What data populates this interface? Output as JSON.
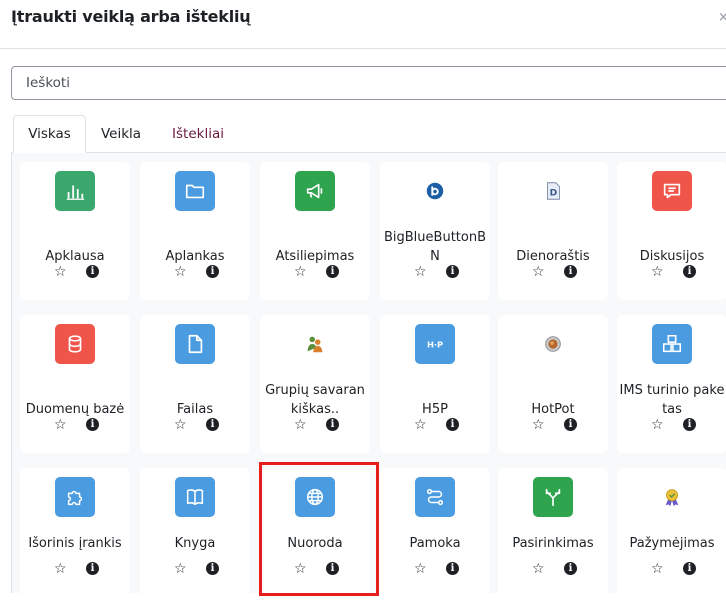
{
  "dialog": {
    "title": "Įtraukti veiklą arba išteklių",
    "close_glyph": "×"
  },
  "search": {
    "placeholder": "Ieškoti",
    "value": ""
  },
  "tabs": [
    {
      "label": "Viskas",
      "active": true
    },
    {
      "label": "Veikla",
      "active": false
    },
    {
      "label": "Ištekliai",
      "active": false
    }
  ],
  "colors": {
    "green": "#2ea44f",
    "blue": "#3e8ed8",
    "red": "#f0554a",
    "highlight": "#e81c1c",
    "link": "#6a1b3f"
  },
  "items": [
    {
      "name": "Apklausa",
      "icon": "bar-chart-icon",
      "color": "#3aa76d"
    },
    {
      "name": "Aplankas",
      "icon": "folder-icon",
      "color": "#4a9be0"
    },
    {
      "name": "Atsiliepimas",
      "icon": "megaphone-icon",
      "color": "#2ea44f"
    },
    {
      "name": "BigBlueButtonBN",
      "icon": "bigbluebutton-icon",
      "color": "#ffffff"
    },
    {
      "name": "Dienoraštis",
      "icon": "journal-icon",
      "color": "#ffffff"
    },
    {
      "name": "Diskusijos",
      "icon": "forum-icon",
      "color": "#f0554a"
    },
    {
      "name": "Duomenų bazė",
      "icon": "database-icon",
      "color": "#f0554a"
    },
    {
      "name": "Failas",
      "icon": "file-icon",
      "color": "#4a9be0"
    },
    {
      "name": "Grupių savarankiškas..",
      "icon": "group-selfselect-icon",
      "color": "#ffffff"
    },
    {
      "name": "H5P",
      "icon": "h5p-icon",
      "color": "#4a9be0"
    },
    {
      "name": "HotPot",
      "icon": "hotpot-icon",
      "color": "#ffffff"
    },
    {
      "name": "IMS turinio paketas",
      "icon": "package-icon",
      "color": "#4a9be0"
    },
    {
      "name": "Išorinis įrankis",
      "icon": "puzzle-icon",
      "color": "#4a9be0"
    },
    {
      "name": "Knyga",
      "icon": "book-icon",
      "color": "#4a9be0"
    },
    {
      "name": "Nuoroda",
      "icon": "globe-icon",
      "color": "#4a9be0",
      "highlighted": true
    },
    {
      "name": "Pamoka",
      "icon": "lesson-path-icon",
      "color": "#4a9be0"
    },
    {
      "name": "Pasirinkimas",
      "icon": "choice-icon",
      "color": "#2ea44f"
    },
    {
      "name": "Pažymėjimas",
      "icon": "certificate-icon",
      "color": "#ffffff"
    }
  ],
  "card_controls": {
    "star_glyph": "☆",
    "info_glyph": "i"
  }
}
